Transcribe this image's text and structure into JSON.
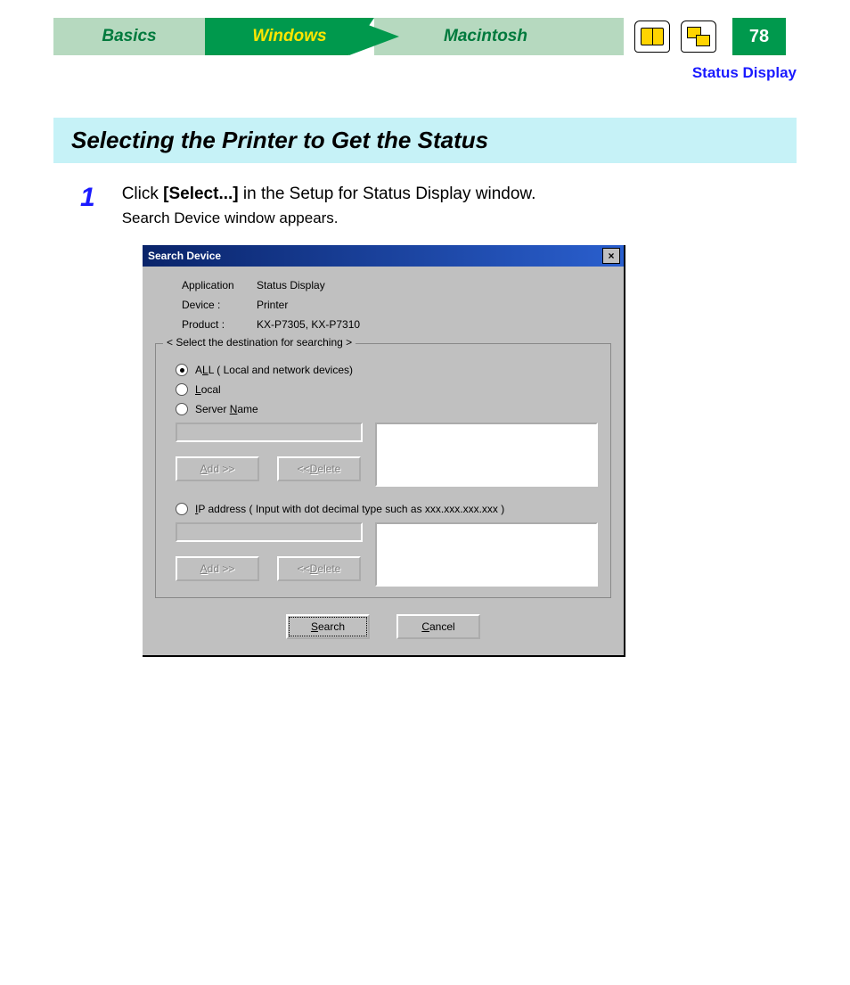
{
  "nav": {
    "tabs": {
      "basics": "Basics",
      "windows": "Windows",
      "macintosh": "Macintosh"
    },
    "page_number": "78"
  },
  "breadcrumb": "Status Display",
  "section_title": "Selecting the Printer to Get the Status",
  "step": {
    "number": "1",
    "prefix": "Click ",
    "bold": "[Select...]",
    "suffix": " in the Setup for Status Display window.",
    "sub": "Search Device window appears."
  },
  "dialog": {
    "title": "Search Device",
    "close": "×",
    "info": {
      "application_label": "Application",
      "application_value": "Status Display",
      "device_label": "Device :",
      "device_value": "Printer",
      "product_label": "Product :",
      "product_value": "KX-P7305, KX-P7310"
    },
    "group_title": "< Select the destination for searching >",
    "options": {
      "all_prefix": "A",
      "all_u": "L",
      "all_suffix": "L ( Local and network devices)",
      "local_u": "L",
      "local_suffix": "ocal",
      "server_prefix": "Server ",
      "server_u": "N",
      "server_suffix": "ame",
      "ip_u": "I",
      "ip_suffix": "P address ( Input with dot decimal type such as xxx.xxx.xxx.xxx )"
    },
    "buttons": {
      "add_u": "A",
      "add_suffix": "dd >>",
      "delete_prefix": "<< ",
      "delete_u": "D",
      "delete_suffix": "elete",
      "search_u": "S",
      "search_suffix": "earch",
      "cancel_u": "C",
      "cancel_suffix": "ancel"
    }
  }
}
